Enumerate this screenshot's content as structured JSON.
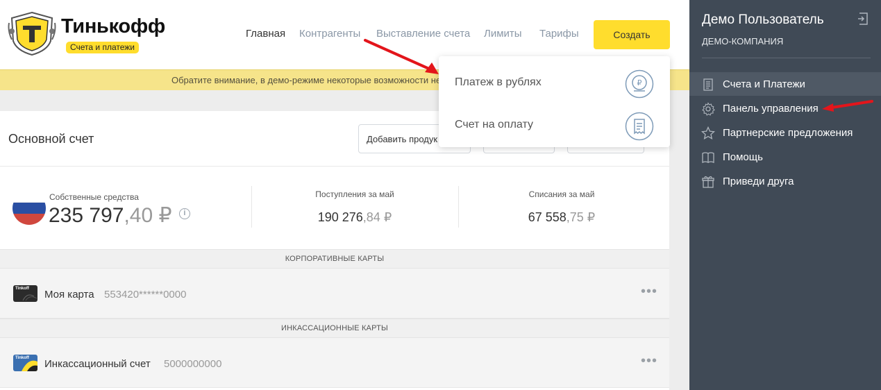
{
  "brand": {
    "name": "Тинькофф",
    "subtitle": "Счета и платежи",
    "accent_color": "#ffdd2d"
  },
  "nav": {
    "items": [
      {
        "label": "Главная",
        "active": true
      },
      {
        "label": "Контрагенты",
        "active": false
      },
      {
        "label": "Выставление счета",
        "active": false
      },
      {
        "label": "Лимиты",
        "active": false
      },
      {
        "label": "Тарифы",
        "active": false
      }
    ],
    "create_button": "Создать"
  },
  "notice": {
    "text": "Обратите внимание, в демо-режиме некоторые возможности нед"
  },
  "account": {
    "title": "Основной счет",
    "add_product_button": "Добавить продук",
    "own_funds": {
      "label": "Собственные средства",
      "amount_int": "235 797",
      "amount_frac": ",40 ₽"
    },
    "income": {
      "label": "Поступления за май",
      "amount_int": "190 276",
      "amount_frac": ",84 ₽"
    },
    "expense": {
      "label": "Списания за май",
      "amount_int": "67 558",
      "amount_frac": ",75 ₽"
    }
  },
  "sections": {
    "corporate_cards": {
      "header": "КОРПОРАТИВНЫЕ КАРТЫ",
      "rows": [
        {
          "name": "Моя карта",
          "number": "553420******0000",
          "card_brand": "Tinkoff"
        }
      ]
    },
    "collection_cards": {
      "header": "ИНКАССАЦИОННЫЕ КАРТЫ",
      "rows": [
        {
          "name": "Инкассационный счет",
          "number": "5000000000",
          "card_brand": "Tinkoff"
        }
      ]
    }
  },
  "dropdown": {
    "items": [
      {
        "label": "Платеж в рублях",
        "icon": "ruble-coin-icon"
      },
      {
        "label": "Счет на оплату",
        "icon": "receipt-icon"
      }
    ]
  },
  "sidebar": {
    "user_name": "Демо Пользователь",
    "company": "ДЕМО-КОМПАНИЯ",
    "background": "#404a56",
    "items": [
      {
        "label": "Счета и Платежи",
        "icon": "document-list-icon",
        "active": true
      },
      {
        "label": "Панель управления",
        "icon": "gear-icon",
        "active": false
      },
      {
        "label": "Партнерские предложения",
        "icon": "star-icon",
        "active": false
      },
      {
        "label": "Помощь",
        "icon": "book-icon",
        "active": false
      },
      {
        "label": "Приведи друга",
        "icon": "gift-icon",
        "active": false
      }
    ]
  },
  "annotations": {
    "arrow_color": "#e3151b"
  }
}
